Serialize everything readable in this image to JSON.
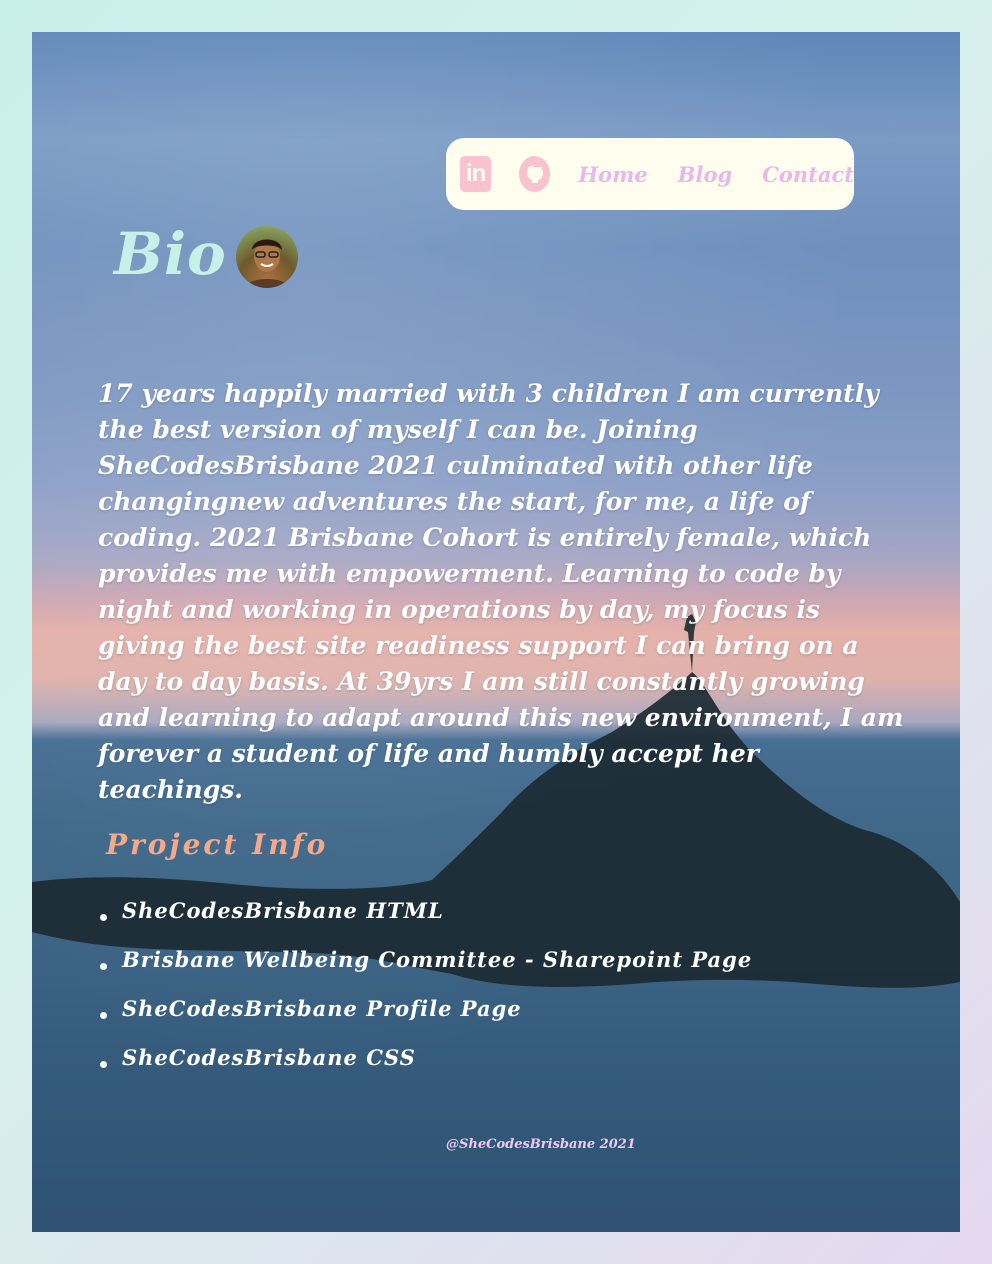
{
  "nav": {
    "linkedin_icon": "linkedin-icon",
    "github_icon": "github-icon",
    "links": [
      "Home",
      "Blog",
      "Contact"
    ]
  },
  "bio": {
    "title": "Bio",
    "text": "17 years happily married with 3 children I am currently the best version of myself I can be. Joining SheCodesBrisbane 2021 culminated with other life changingnew adventures the start, for me, a life of coding. 2021 Brisbane Cohort is entirely female, which provides me with empowerment. Learning to code by night and working in operations by day, my focus is giving the best site readiness support I can bring on a day to day basis. At 39yrs I am still constantly growing and learning to adapt around this new environment, I am forever a student of life and humbly accept her teachings."
  },
  "projects": {
    "title": "Project Info",
    "items": [
      "SheCodesBrisbane HTML",
      "Brisbane Wellbeing Committee - Sharepoint Page",
      "SheCodesBrisbane Profile Page",
      "SheCodesBrisbane CSS"
    ]
  },
  "footer": {
    "text": "@SheCodesBrisbane 2021"
  },
  "colors": {
    "nav_bg": "#fffeee",
    "nav_link": "#e8b8ec",
    "icon_bg": "#f9c2cf",
    "bio_title": "#c9f0e8",
    "project_title": "#f3a98a"
  }
}
